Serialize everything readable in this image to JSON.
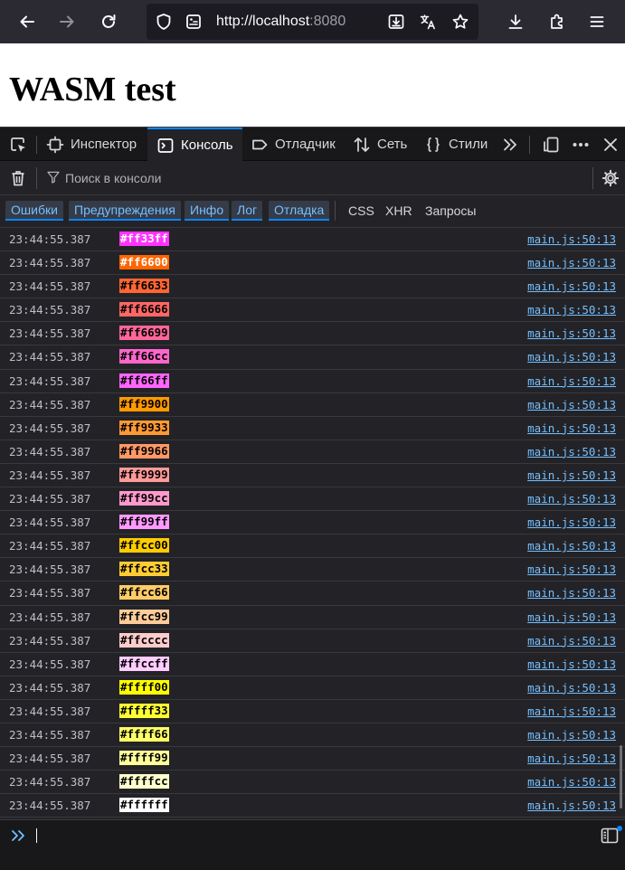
{
  "browser": {
    "url_host": "http://localhost",
    "url_port": ":8080"
  },
  "page": {
    "heading": "WASM test"
  },
  "devtools": {
    "tabs": [
      {
        "label": "Инспектор",
        "icon": "inspector-icon"
      },
      {
        "label": "Консоль",
        "icon": "console-icon",
        "active": true
      },
      {
        "label": "Отладчик",
        "icon": "debugger-icon"
      },
      {
        "label": "Сеть",
        "icon": "network-icon"
      },
      {
        "label": "Стили",
        "icon": "style-editor-icon"
      }
    ],
    "filter_placeholder": "Поиск в консоли",
    "levels": [
      "Ошибки",
      "Предупреждения",
      "Инфо",
      "Лог",
      "Отладка"
    ],
    "extra_filters": [
      "CSS",
      "XHR",
      "Запросы"
    ],
    "accent_color": "#0a84ff"
  },
  "console": {
    "messages": [
      {
        "time": "23:44:55.387",
        "text": "#ff33ff",
        "bg": "#ff33ff",
        "fg": "#ffffff",
        "source": "main.js:50:13"
      },
      {
        "time": "23:44:55.387",
        "text": "#ff6600",
        "bg": "#ff6600",
        "fg": "#ffffff",
        "source": "main.js:50:13"
      },
      {
        "time": "23:44:55.387",
        "text": "#ff6633",
        "bg": "#ff6633",
        "fg": "#000000",
        "source": "main.js:50:13"
      },
      {
        "time": "23:44:55.387",
        "text": "#ff6666",
        "bg": "#ff6666",
        "fg": "#000000",
        "source": "main.js:50:13"
      },
      {
        "time": "23:44:55.387",
        "text": "#ff6699",
        "bg": "#ff6699",
        "fg": "#000000",
        "source": "main.js:50:13"
      },
      {
        "time": "23:44:55.387",
        "text": "#ff66cc",
        "bg": "#ff66cc",
        "fg": "#000000",
        "source": "main.js:50:13"
      },
      {
        "time": "23:44:55.387",
        "text": "#ff66ff",
        "bg": "#ff66ff",
        "fg": "#000000",
        "source": "main.js:50:13"
      },
      {
        "time": "23:44:55.387",
        "text": "#ff9900",
        "bg": "#ff9900",
        "fg": "#000000",
        "source": "main.js:50:13"
      },
      {
        "time": "23:44:55.387",
        "text": "#ff9933",
        "bg": "#ff9933",
        "fg": "#000000",
        "source": "main.js:50:13"
      },
      {
        "time": "23:44:55.387",
        "text": "#ff9966",
        "bg": "#ff9966",
        "fg": "#000000",
        "source": "main.js:50:13"
      },
      {
        "time": "23:44:55.387",
        "text": "#ff9999",
        "bg": "#ff9999",
        "fg": "#000000",
        "source": "main.js:50:13"
      },
      {
        "time": "23:44:55.387",
        "text": "#ff99cc",
        "bg": "#ff99cc",
        "fg": "#000000",
        "source": "main.js:50:13"
      },
      {
        "time": "23:44:55.387",
        "text": "#ff99ff",
        "bg": "#ff99ff",
        "fg": "#000000",
        "source": "main.js:50:13"
      },
      {
        "time": "23:44:55.387",
        "text": "#ffcc00",
        "bg": "#ffcc00",
        "fg": "#000000",
        "source": "main.js:50:13"
      },
      {
        "time": "23:44:55.387",
        "text": "#ffcc33",
        "bg": "#ffcc33",
        "fg": "#000000",
        "source": "main.js:50:13"
      },
      {
        "time": "23:44:55.387",
        "text": "#ffcc66",
        "bg": "#ffcc66",
        "fg": "#000000",
        "source": "main.js:50:13"
      },
      {
        "time": "23:44:55.387",
        "text": "#ffcc99",
        "bg": "#ffcc99",
        "fg": "#000000",
        "source": "main.js:50:13"
      },
      {
        "time": "23:44:55.387",
        "text": "#ffcccc",
        "bg": "#ffcccc",
        "fg": "#000000",
        "source": "main.js:50:13"
      },
      {
        "time": "23:44:55.387",
        "text": "#ffccff",
        "bg": "#ffccff",
        "fg": "#000000",
        "source": "main.js:50:13"
      },
      {
        "time": "23:44:55.387",
        "text": "#ffff00",
        "bg": "#ffff00",
        "fg": "#000000",
        "source": "main.js:50:13"
      },
      {
        "time": "23:44:55.387",
        "text": "#ffff33",
        "bg": "#ffff33",
        "fg": "#000000",
        "source": "main.js:50:13"
      },
      {
        "time": "23:44:55.387",
        "text": "#ffff66",
        "bg": "#ffff66",
        "fg": "#000000",
        "source": "main.js:50:13"
      },
      {
        "time": "23:44:55.387",
        "text": "#ffff99",
        "bg": "#ffff99",
        "fg": "#000000",
        "source": "main.js:50:13"
      },
      {
        "time": "23:44:55.387",
        "text": "#ffffcc",
        "bg": "#ffffcc",
        "fg": "#000000",
        "source": "main.js:50:13"
      },
      {
        "time": "23:44:55.387",
        "text": "#ffffff",
        "bg": "#ffffff",
        "fg": "#000000",
        "source": "main.js:50:13"
      }
    ]
  }
}
